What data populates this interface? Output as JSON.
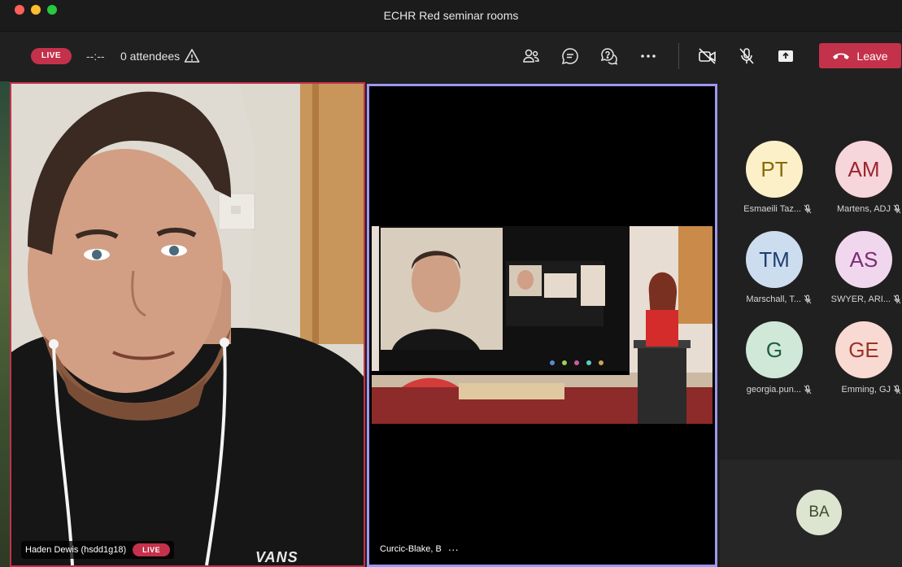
{
  "window": {
    "title": "ECHR Red seminar rooms"
  },
  "toolbar": {
    "live_label": "LIVE",
    "timer": "--:--",
    "attendees": "0 attendees",
    "icons": [
      "participants-icon",
      "chat-icon",
      "qa-icon",
      "more-icon",
      "camera-off-icon",
      "mic-off-icon",
      "share-icon"
    ],
    "leave_label": "Leave"
  },
  "main": {
    "left_tile": {
      "name": "Haden Dewis (hsdd1g18)",
      "live_label": "LIVE",
      "shirt_text": "VANS"
    },
    "center_tile": {
      "name": "Curcic-Blake, B",
      "more": "···"
    }
  },
  "roster": [
    {
      "initials": "PT",
      "name": "Esmaeili Taz...",
      "bg": "#fbf0c8",
      "fg": "#8a6a07"
    },
    {
      "initials": "AM",
      "name": "Martens, ADJ",
      "bg": "#f6d6da",
      "fg": "#9b2533"
    },
    {
      "initials": "TM",
      "name": "Marschall, T...",
      "bg": "#cdddf0",
      "fg": "#1f3f6e"
    },
    {
      "initials": "AS",
      "name": "SWYER, ARI...",
      "bg": "#f1d7ee",
      "fg": "#7a2e73"
    },
    {
      "initials": "G",
      "name": "georgia.pun...",
      "bg": "#cfe8d8",
      "fg": "#1f5e3a"
    },
    {
      "initials": "GE",
      "name": "Emming, GJ",
      "bg": "#f8dad3",
      "fg": "#9b3424"
    }
  ],
  "overflow": {
    "initials": "BA"
  },
  "colors": {
    "accent_red": "#c4314b",
    "active_speaker": "#9e97f0"
  }
}
